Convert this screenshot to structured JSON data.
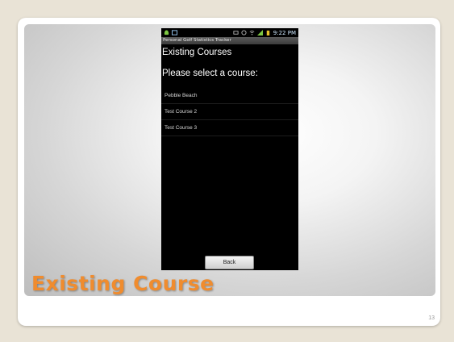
{
  "slide": {
    "title": "Existing Course",
    "number": "13",
    "title_color": "#f08c2e"
  },
  "phone": {
    "status_bar": {
      "time": "9:22 PM",
      "icons": [
        "android-icon",
        "image-icon",
        "mute-icon",
        "alarm-icon",
        "wifi-icon",
        "signal-icon",
        "battery-icon"
      ]
    },
    "app_title": "Personal Golf Statistics Tracker",
    "heading": "Existing Courses",
    "prompt": "Please select a course:",
    "courses": [
      "Pebble Beach",
      "Test Course 2",
      "Test Course 3"
    ],
    "back_label": "Back"
  }
}
